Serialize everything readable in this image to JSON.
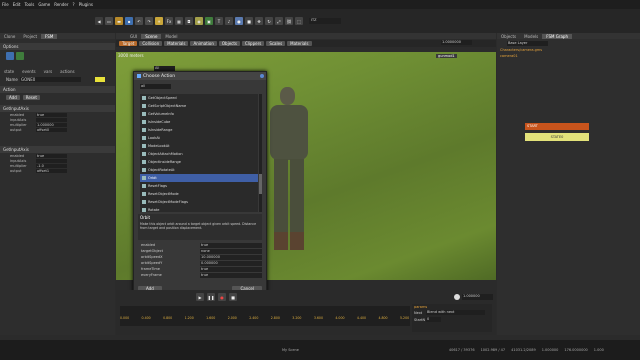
{
  "menu": [
    "File",
    "Edit",
    "Tools",
    "Game",
    "Render",
    "?",
    "Plugins"
  ],
  "toolbar": {
    "fx_label": "Fx",
    "text_tool": "T",
    "dropdown_value": "ITZ"
  },
  "left_panel": {
    "tabs": [
      "Clone",
      "Project",
      "FSM"
    ],
    "options_header": "Options",
    "subtabs": [
      "state",
      "events",
      "vars",
      "actions"
    ],
    "name_label": "Name",
    "name_value": "GONE0",
    "action_header": "Action",
    "action_buttons": [
      "Add",
      "Reset"
    ],
    "sections": [
      {
        "title": "GetInputAxis",
        "rows": [
          {
            "label": "enabled",
            "value": "true"
          },
          {
            "label": "inputAxis",
            "value": ""
          },
          {
            "label": "multiplier",
            "value": "1.000000"
          },
          {
            "label": "output",
            "value": "offset0"
          }
        ]
      },
      {
        "title": "GetInputAxis",
        "rows": [
          {
            "label": "enabled",
            "value": "true"
          },
          {
            "label": "inputAxis",
            "value": ""
          },
          {
            "label": "multiplier",
            "value": "-1.0"
          },
          {
            "label": "output",
            "value": "offset1"
          }
        ]
      }
    ]
  },
  "viewport": {
    "tabs": [
      "GUI",
      "Scene",
      "Model"
    ],
    "subtabs": [
      "Target",
      "Collision",
      "Materials",
      "Animation",
      "Objects",
      "Clippers",
      "Scales",
      "Materials"
    ],
    "mode_label": "3000 meters",
    "overlay_field": "All",
    "zoom_value": "1.0000000",
    "object_label": "gunmod1"
  },
  "dialog": {
    "title": "Choose Action",
    "filter_value": "all",
    "items": [
      "GetObjectSpeed",
      "GetScriptObjectName",
      "GetVolumeInfo",
      "IsInsideCube",
      "IsInsideRange",
      "LookAt",
      "ModeLookAt",
      "ObjectAttachMotion",
      "ObjectInsideRange",
      "ObjectRotateAt",
      "Orbit",
      "ResetFlags",
      "ResetObjectMode",
      "ResetObjectModeFlags",
      "Rotate",
      "RotateMode",
      "SetCameraAlpha"
    ],
    "selected_index": 10,
    "info_label": "Orbit",
    "info_text": "Make this object orbit around a target object given orbit speed. Distance from target and position displacement.",
    "props": [
      {
        "name": "enabled",
        "value": "true"
      },
      {
        "name": "targetObject",
        "value": "none"
      },
      {
        "name": "orbitSpeedX",
        "value": "10.000000"
      },
      {
        "name": "orbitSpeedY",
        "value": "0.000000"
      },
      {
        "name": "frameTime",
        "value": "true"
      },
      {
        "name": "everyFrame",
        "value": "true"
      }
    ],
    "ok_label": "Add",
    "cancel_label": "Cancel"
  },
  "timeline": {
    "ticks": [
      "0.000",
      "0.400",
      "0.800",
      "1.200",
      "1.600",
      "2.000",
      "2.400",
      "2.800",
      "3.200",
      "3.600",
      "4.000",
      "4.400",
      "4.800",
      "5.200"
    ],
    "time_value": "1.000000",
    "params_title": "params",
    "param_next_label": "Next",
    "param_next_value": "Blend with next",
    "param_start_label": "StartN",
    "param_start_value": "0"
  },
  "right_panel": {
    "tabs": [
      "Objects",
      "Models",
      "FSM Graph"
    ],
    "layer_value": "Base Layer",
    "path_text": "Characters/camera.gms",
    "object_name": "camera01",
    "node_start": "START",
    "node_state": "STATE0"
  },
  "status": {
    "center": "My Scene",
    "values": [
      "40617 / 39376",
      "1002.989 / 47",
      "41031.2/2089",
      "1.000000",
      "176.0000000",
      "1.000"
    ]
  }
}
